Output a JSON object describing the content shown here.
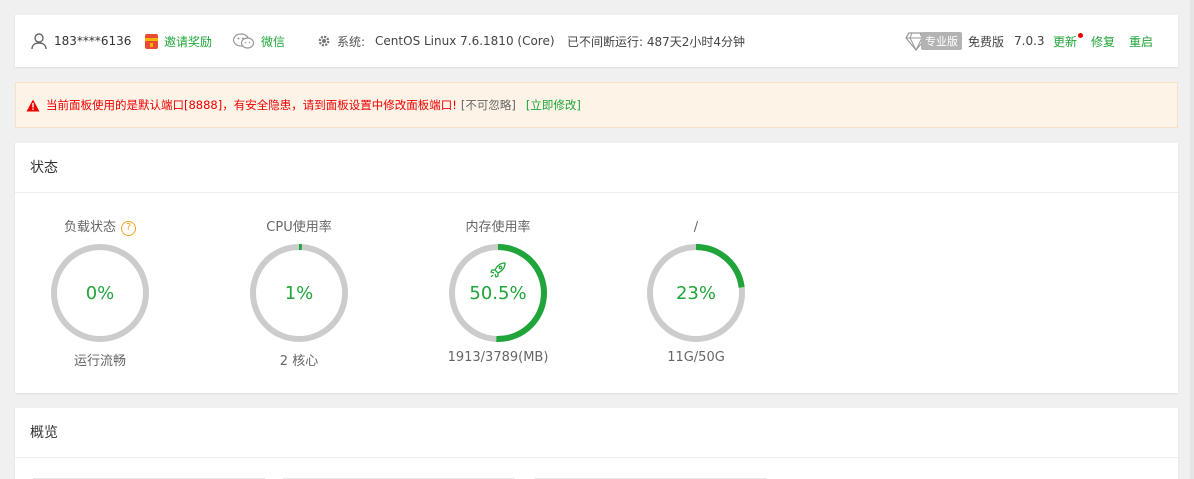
{
  "topbar": {
    "user": "183****6136",
    "invite": "邀请奖励",
    "wechat": "微信",
    "system_label": "系统:",
    "system_value": "CentOS Linux 7.6.1810 (Core)",
    "uptime": "已不间断运行: 487天2小时4分钟",
    "pro_badge": "专业版",
    "edition": "免费版",
    "version": "7.0.3",
    "update": "更新",
    "repair": "修复",
    "restart": "重启"
  },
  "alert": {
    "message": "当前面板使用的是默认端口[8888]，有安全隐患，请到面板设置中修改面板端口!",
    "ignore": "[不可忽略]",
    "fix": "[立即修改]"
  },
  "status": {
    "title": "状态",
    "gauges": [
      {
        "title": "负载状态",
        "percent": 0,
        "value_text": "0%",
        "sub": "运行流畅"
      },
      {
        "title": "CPU使用率",
        "percent": 1,
        "value_text": "1%",
        "sub": "2 核心"
      },
      {
        "title": "内存使用率",
        "percent": 50.5,
        "value_text": "50.5%",
        "sub": "1913/3789(MB)"
      },
      {
        "title": "/",
        "percent": 23,
        "value_text": "23%",
        "sub": "11G/50G"
      }
    ]
  },
  "overview": {
    "title": "概览"
  },
  "colors": {
    "accent": "#20a53a",
    "ring_bg": "#cccccc",
    "alert_text": "#ee0000"
  }
}
